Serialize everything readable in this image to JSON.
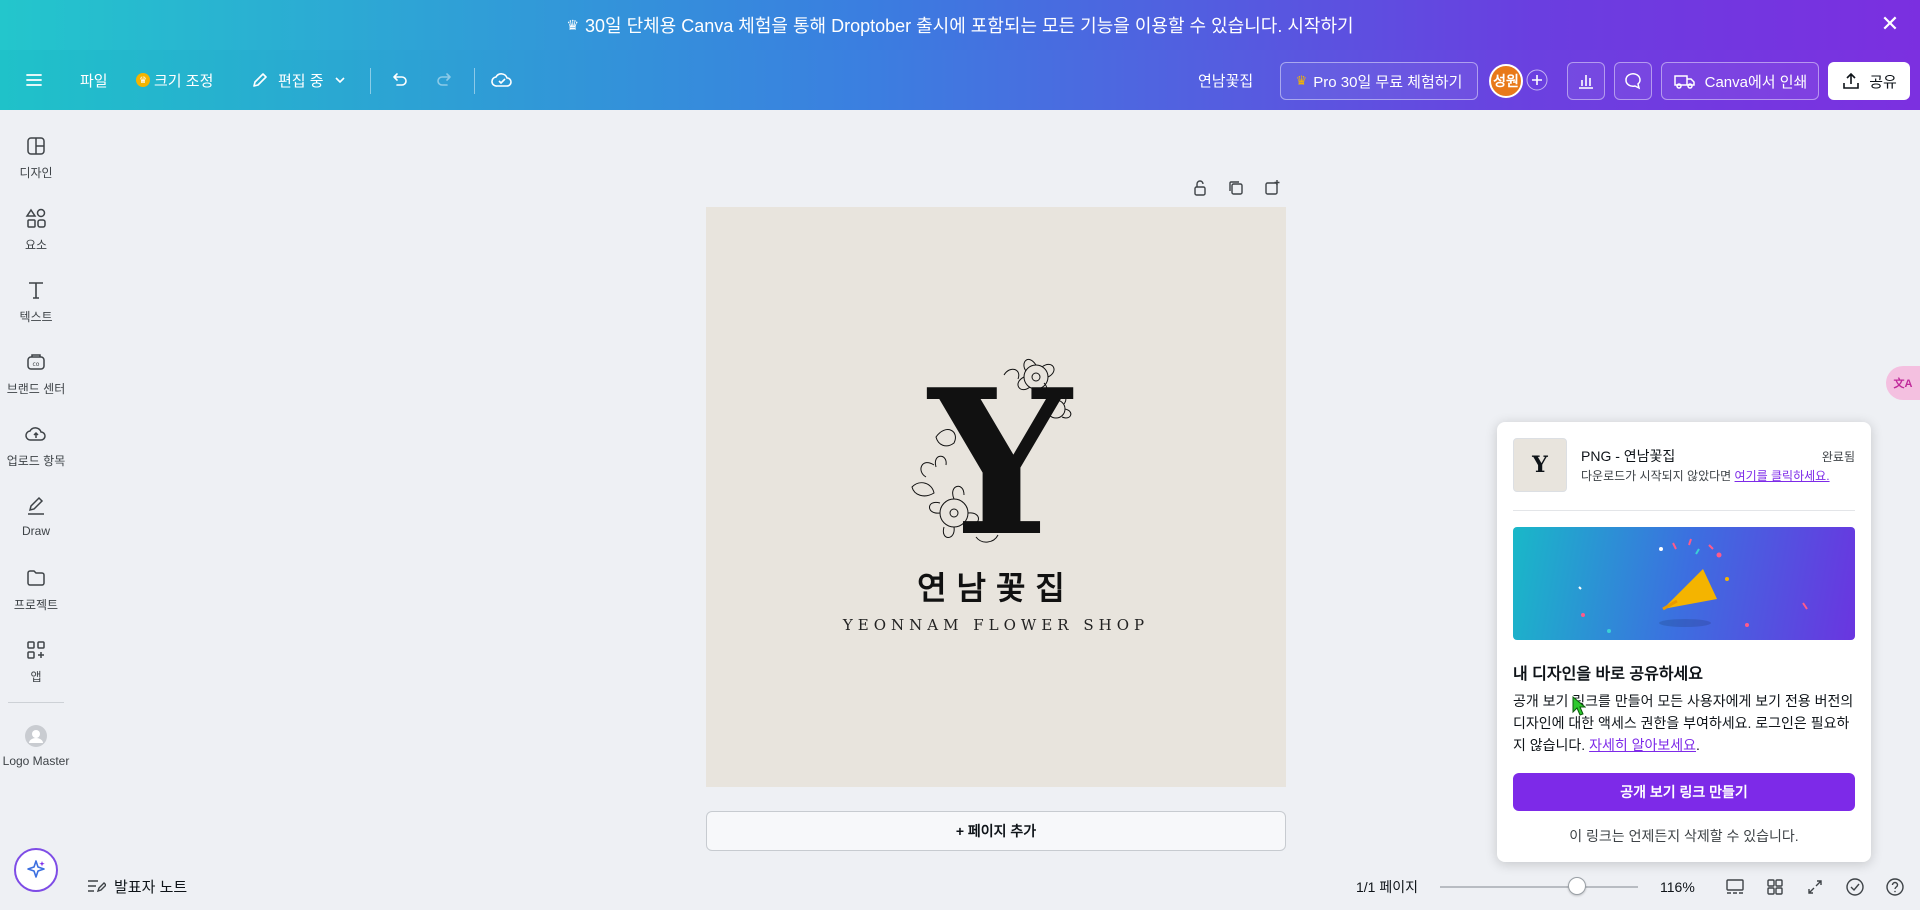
{
  "banner": {
    "text": "30일 단체용 Canva 체험을 통해 Droptober 출시에 포함되는 모든 기능을 이용할 수 있습니다. 시작하기",
    "crown": "♛",
    "close": "✕"
  },
  "toolbar": {
    "file": "파일",
    "resize": "크기 조정",
    "editing": "편집 중",
    "project_name": "연남꽃집",
    "pro_trial": "Pro 30일 무료 체험하기",
    "avatar_initials": "성원",
    "print": "Canva에서 인쇄",
    "share": "공유"
  },
  "sidebar": {
    "items": [
      {
        "label": "디자인",
        "icon": "design-icon"
      },
      {
        "label": "요소",
        "icon": "elements-icon"
      },
      {
        "label": "텍스트",
        "icon": "text-icon"
      },
      {
        "label": "브랜드 센터",
        "icon": "brand-icon"
      },
      {
        "label": "업로드 항목",
        "icon": "upload-icon"
      },
      {
        "label": "Draw",
        "icon": "draw-icon"
      },
      {
        "label": "프로젝트",
        "icon": "folder-icon"
      },
      {
        "label": "앱",
        "icon": "apps-icon"
      },
      {
        "label": "Logo Master",
        "icon": "logo-master-icon"
      }
    ]
  },
  "canvas": {
    "logo_letter": "Y",
    "logo_title": "연남꽃집",
    "logo_subtitle": "YEONNAM FLOWER SHOP",
    "add_page": "+ 페이지 추가"
  },
  "bottom": {
    "notes": "발표자 노트",
    "page_counter": "1/1 페이지",
    "zoom": "116%",
    "zoom_fraction": 0.69
  },
  "popup": {
    "file_title": "PNG - 연남꽃집",
    "status": "완료됨",
    "download_hint": "다운로드가 시작되지 않았다면",
    "download_link": "여기를 클릭하세요.",
    "heading": "내 디자인을 바로 공유하세요",
    "body": "공개 보기 링크를 만들어 모든 사용자에게 보기 전용 버전의 디자인에 대한 액세스 권한을 부여하세요. 로그인은 필요하지 않습니다.",
    "learn_more": "자세히 알아보세요",
    "cta": "공개 보기 링크 만들기",
    "footer": "이 링크는 언제든지 삭제할 수 있습니다."
  },
  "side_tab": "文A",
  "colors": {
    "accent": "#7d2ae8",
    "canvas_bg": "#e8e4dd",
    "avatar": "#e8791a"
  }
}
